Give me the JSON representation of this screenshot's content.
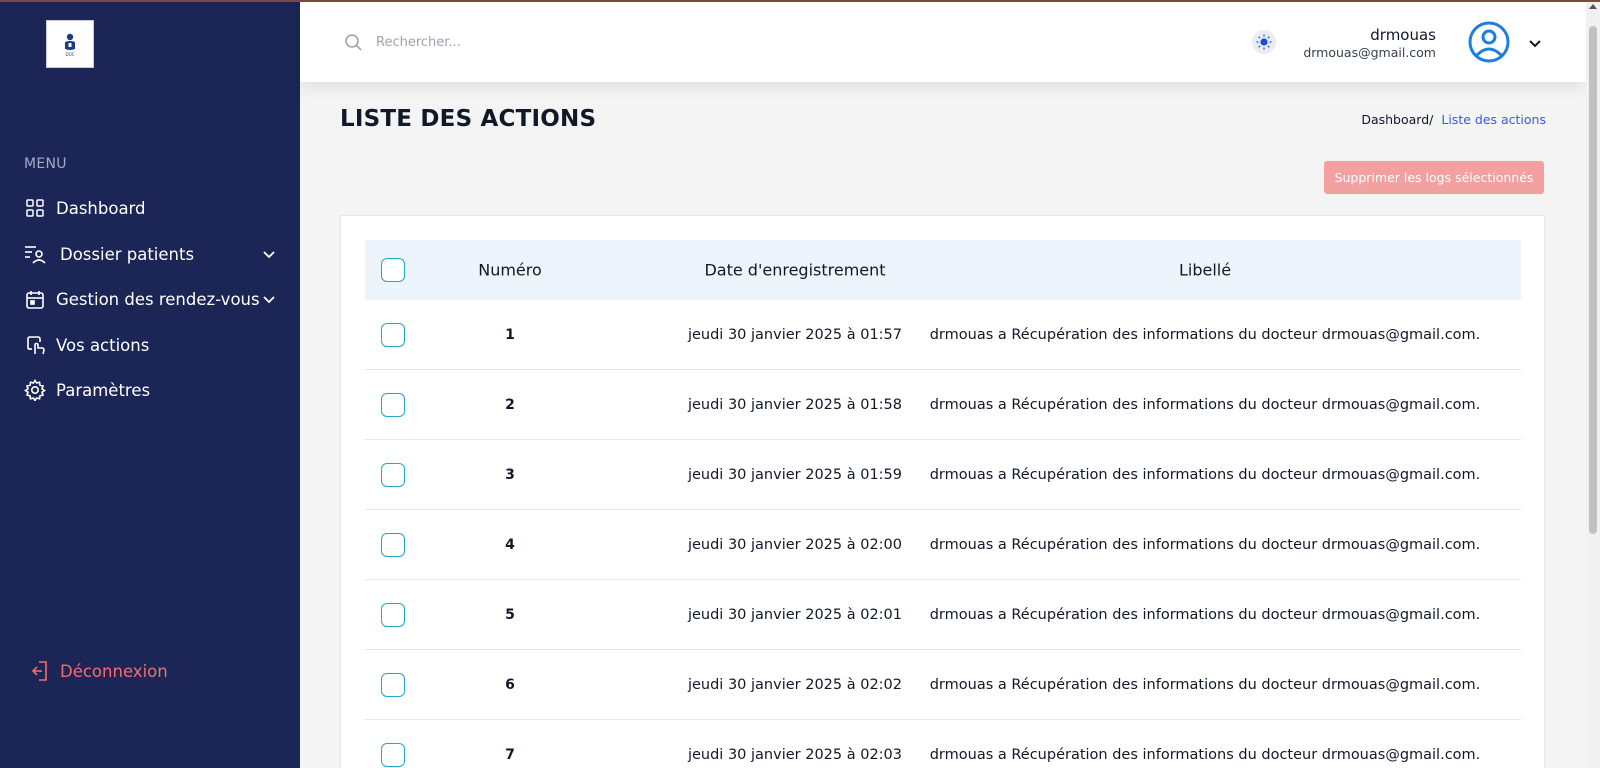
{
  "sidebar": {
    "logo_text": "DOC",
    "menu_title": "MENU",
    "items": [
      {
        "label": "Dashboard",
        "icon": "grid-icon"
      },
      {
        "label": "Dossier patients",
        "icon": "patients-icon",
        "has_submenu": true
      },
      {
        "label": "Gestion des rendez-vous",
        "icon": "calendar-icon",
        "has_submenu": true
      },
      {
        "label": "Vos actions",
        "icon": "actions-icon"
      },
      {
        "label": "Paramètres",
        "icon": "gear-icon"
      }
    ],
    "logout_label": "Déconnexion"
  },
  "header": {
    "search_placeholder": "Rechercher...",
    "user_name": "drmouas",
    "user_email": "drmouas@gmail.com"
  },
  "page": {
    "title": "LISTE DES ACTIONS",
    "breadcrumb_home": "Dashboard",
    "breadcrumb_sep": "/",
    "breadcrumb_current": "Liste des actions",
    "delete_button": "Supprimer les logs sélectionnés"
  },
  "table": {
    "columns": [
      "Numéro",
      "Date d'enregistrement",
      "Libellé"
    ],
    "rows": [
      {
        "num": "1",
        "date": "jeudi 30 janvier 2025 à 01:57",
        "libelle": "drmouas a Récupération des informations du docteur drmouas@gmail.com."
      },
      {
        "num": "2",
        "date": "jeudi 30 janvier 2025 à 01:58",
        "libelle": "drmouas a Récupération des informations du docteur drmouas@gmail.com."
      },
      {
        "num": "3",
        "date": "jeudi 30 janvier 2025 à 01:59",
        "libelle": "drmouas a Récupération des informations du docteur drmouas@gmail.com."
      },
      {
        "num": "4",
        "date": "jeudi 30 janvier 2025 à 02:00",
        "libelle": "drmouas a Récupération des informations du docteur drmouas@gmail.com."
      },
      {
        "num": "5",
        "date": "jeudi 30 janvier 2025 à 02:01",
        "libelle": "drmouas a Récupération des informations du docteur drmouas@gmail.com."
      },
      {
        "num": "6",
        "date": "jeudi 30 janvier 2025 à 02:02",
        "libelle": "drmouas a Récupération des informations du docteur drmouas@gmail.com."
      },
      {
        "num": "7",
        "date": "jeudi 30 janvier 2025 à 02:03",
        "libelle": "drmouas a Récupération des informations du docteur drmouas@gmail.com."
      }
    ]
  },
  "colors": {
    "sidebar_bg": "#1b2656",
    "accent_blue": "#3b5bdb",
    "logout_red": "#f26d6d",
    "delete_btn": "#f3a0a0",
    "checkbox_border": "#22a6c9",
    "table_header_bg": "#eef4fc"
  }
}
